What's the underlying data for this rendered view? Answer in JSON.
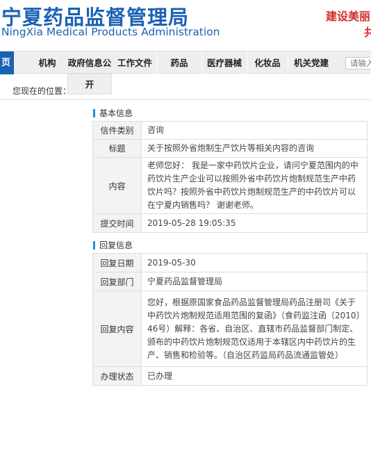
{
  "header": {
    "title_cn": "宁夏药品监督管理局",
    "title_en": "NingXia Medical Products Administration",
    "slogan_line1": "建设美丽",
    "slogan_line2": "共"
  },
  "nav": {
    "home": "页",
    "items": [
      "机构",
      "政府信息公",
      "工作文件",
      "药品",
      "医疗器械",
      "化妆品",
      "机关党建"
    ],
    "search_placeholder": "请输入",
    "dropdown_item": "开"
  },
  "location_label": "您现在的位置：",
  "basic_info": {
    "section_title": "基本信息",
    "rows": [
      {
        "key": "信件类别",
        "value": "咨询"
      },
      {
        "key": "标题",
        "value": "关于按照外省炮制生产饮片等相关内容的咨询"
      },
      {
        "key": "内容",
        "value": "老师您好： 我是一家中药饮片企业，请问宁夏范围内的中药饮片生产企业可以按照外省中药饮片炮制规范生产中药饮片吗？按照外省中药饮片炮制规范生产的中药饮片可以在宁夏内销售吗？ 谢谢老师。"
      },
      {
        "key": "提交时间",
        "value": "2019-05-28 19:05:35"
      }
    ]
  },
  "reply_info": {
    "section_title": "回复信息",
    "rows": [
      {
        "key": "回复日期",
        "value": "2019-05-30"
      },
      {
        "key": "回复部门",
        "value": "宁夏药品监督管理局"
      },
      {
        "key": "回复内容",
        "value": "您好，根据原国家食品药品监督管理局药品注册司《关于中药饮片炮制规范适用范围的复函》（食药监注函〔2010〕46号）解释：各省、自治区、直辖市药品监督部门制定、颁布的中药饮片炮制规范仅适用于本辖区内中药饮片的生产、销售和检验等。（自治区药监局药品流通监管处）"
      },
      {
        "key": "办理状态",
        "value": "已办理"
      }
    ]
  },
  "colors": {
    "brand_blue": "#1a62b5",
    "slogan_red": "#d32a2a",
    "section_marker": "#1a8fe0"
  }
}
